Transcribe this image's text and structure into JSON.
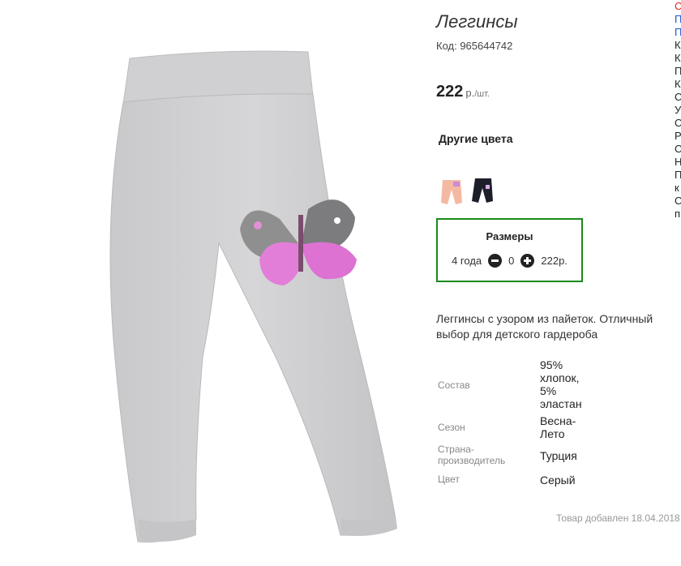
{
  "product": {
    "title": "Леггинсы",
    "code": "Код: 965644742",
    "price": "222",
    "price_unit": "р.",
    "price_per": "/шт."
  },
  "other_colors": {
    "title": "Другие цвета",
    "swatches": [
      {
        "color": "#f4b9a3",
        "icon": "pink-leggings-thumbnail"
      },
      {
        "color": "#1c1f2a",
        "icon": "black-leggings-thumbnail"
      }
    ]
  },
  "sizes": {
    "title": "Размеры",
    "size": "4 года",
    "quantity": "0",
    "price": "222р.",
    "border_color": "#1a8a1a"
  },
  "description": "Леггинсы с узором из пайеток. Отличный выбор для детского гардероба",
  "specs": [
    {
      "label": "Состав",
      "value": "95% хлопок, 5% эластан"
    },
    {
      "label": "Сезон",
      "value": "Весна-Лето"
    },
    {
      "label": "Страна-производитель",
      "value": "Турция"
    },
    {
      "label": "Цвет",
      "value": "Серый"
    }
  ],
  "added": "Товар добавлен 18.04.2018",
  "right_column": [
    {
      "text": "С",
      "color": "#d22"
    },
    {
      "text": "П",
      "color": "#2255cc"
    },
    {
      "text": "П",
      "color": "#2255cc"
    },
    {
      "text": "К",
      "color": "#222"
    },
    {
      "text": "К",
      "color": "#222"
    },
    {
      "text": "П",
      "color": "#222"
    },
    {
      "text": "К",
      "color": "#222"
    },
    {
      "text": "С",
      "color": "#222"
    },
    {
      "text": "У",
      "color": "#222"
    },
    {
      "text": "С",
      "color": "#222"
    },
    {
      "text": "Р",
      "color": "#222"
    },
    {
      "text": "С",
      "color": "#222"
    },
    {
      "text": "Н",
      "color": "#222"
    },
    {
      "text": "П",
      "color": "#222"
    },
    {
      "text": "к",
      "color": "#222"
    },
    {
      "text": "С",
      "color": "#222"
    },
    {
      "text": "п",
      "color": "#222"
    }
  ]
}
